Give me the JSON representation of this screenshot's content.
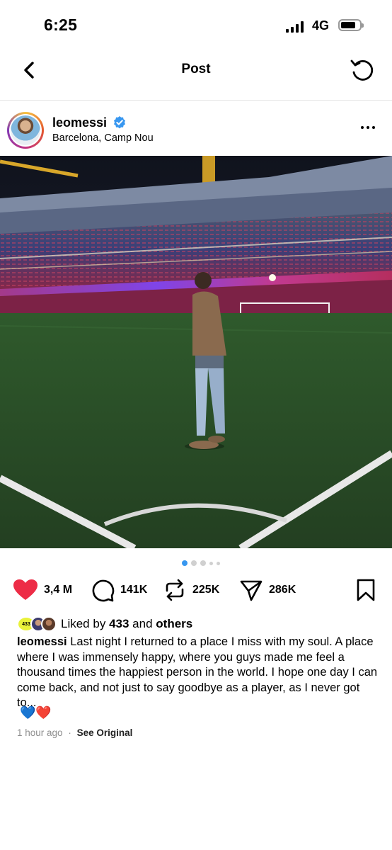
{
  "status_bar": {
    "time": "6:25",
    "network": "4G"
  },
  "nav": {
    "title": "Post"
  },
  "post": {
    "username": "leomessi",
    "location": "Barcelona, Camp Nou",
    "carousel": {
      "count": 5,
      "active_index": 0
    }
  },
  "actions": {
    "likes": "3,4 M",
    "comments": "141K",
    "reposts": "225K",
    "shares": "286K"
  },
  "liked_by": {
    "prefix": "Liked by",
    "account": "433",
    "joiner": "and",
    "others": "others",
    "badge": "433"
  },
  "caption": {
    "username": "leomessi",
    "text": "Last night I returned to a place I miss with my soul. A place where I was immensely happy, where you guys made me feel a thousand times the happiest person in the world. I hope one day I can come back, and not just to say goodbye as a player, as I never got to...",
    "emoji": "💙❤️"
  },
  "meta": {
    "time_ago": "1 hour ago",
    "separator": "·",
    "see_original": "See Original"
  },
  "colors": {
    "like_red": "#ed2c46",
    "verified_blue": "#3897f0",
    "carousel_active": "#3897f0",
    "grass": "#2d5a2b"
  }
}
